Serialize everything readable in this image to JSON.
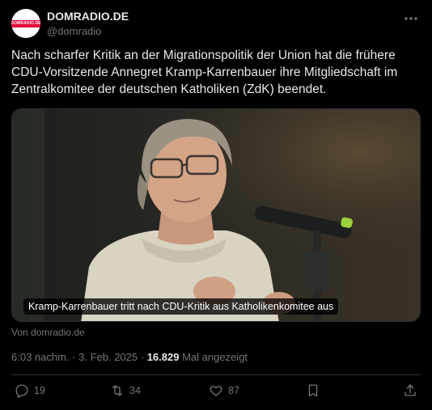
{
  "account": {
    "display_name": "DOMRADIO.DE",
    "handle": "@domradio",
    "avatar_text": "DOMRADIO.DE"
  },
  "tweet": {
    "text": "Nach scharfer Kritik an der  Migrationspolitik der Union hat die frühere\nCDU-Vorsitzende Annegret  Kramp-Karrenbauer ihre Mitgliedschaft im\nZentralkomitee der deutschen  Katholiken (ZdK) beendet.",
    "media_caption": "Kramp-Karrenbauer tritt nach CDU-Kritik aus Katholikenkomitee aus",
    "source": "Von domradio.de",
    "time": "6:03 nachm.",
    "date": "3. Feb. 2025",
    "views": "16.829",
    "views_label": "Mal angezeigt"
  },
  "actions": {
    "replies": "19",
    "reposts": "34",
    "likes": "87"
  },
  "icons": [
    "more-icon",
    "reply-icon",
    "repost-icon",
    "like-icon",
    "bookmark-icon",
    "share-icon"
  ],
  "colors": {
    "background": "#000000",
    "text": "#e7e9ea",
    "muted": "#71767b",
    "border": "#2f3336",
    "brand_red": "#e3003b"
  }
}
